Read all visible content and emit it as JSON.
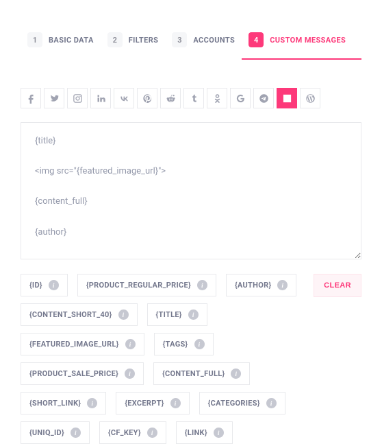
{
  "tabs": [
    {
      "num": "1",
      "label": "BASIC DATA",
      "active": false
    },
    {
      "num": "2",
      "label": "FILTERS",
      "active": false
    },
    {
      "num": "3",
      "label": "ACCOUNTS",
      "active": false
    },
    {
      "num": "4",
      "label": "CUSTOM MESSAGES",
      "active": true
    }
  ],
  "socials": [
    {
      "name": "facebook",
      "active": false
    },
    {
      "name": "twitter",
      "active": false
    },
    {
      "name": "instagram",
      "active": false
    },
    {
      "name": "linkedin",
      "active": false
    },
    {
      "name": "vk",
      "active": false
    },
    {
      "name": "pinterest",
      "active": false
    },
    {
      "name": "reddit",
      "active": false
    },
    {
      "name": "tumblr",
      "active": false
    },
    {
      "name": "odnoklassniki",
      "active": false
    },
    {
      "name": "google",
      "active": false
    },
    {
      "name": "telegram",
      "active": false
    },
    {
      "name": "medium",
      "active": true
    },
    {
      "name": "wordpress",
      "active": false
    }
  ],
  "editor": {
    "value": "{title}\n\n<img src=\"{featured_image_url}\">\n\n{content_full}\n\n{author}"
  },
  "chips": [
    "{ID}",
    "{PRODUCT_REGULAR_PRICE}",
    "{AUTHOR}",
    "{CONTENT_SHORT_40}",
    "{TITLE}",
    "{FEATURED_IMAGE_URL}",
    "{TAGS}",
    "{PRODUCT_SALE_PRICE}",
    "{CONTENT_FULL}",
    "{SHORT_LINK}",
    "{EXCERPT}",
    "{CATEGORIES}",
    "{UNIQ_ID}",
    "{CF_KEY}",
    "{LINK}"
  ],
  "clear_label": "CLEAR"
}
